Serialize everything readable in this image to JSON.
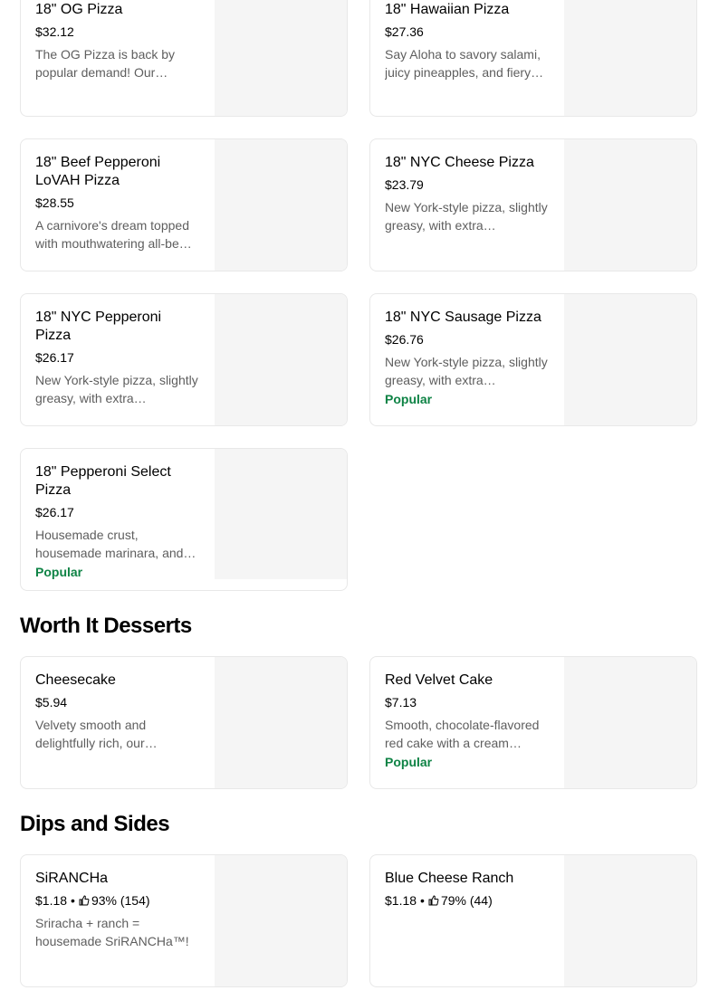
{
  "sections": {
    "desserts_heading": "Worth It Desserts",
    "dips_heading": "Dips and Sides"
  },
  "items": {
    "og_pizza": {
      "title": "18\" OG Pizza",
      "price": "$32.12",
      "desc": "The OG Pizza is back by popular demand! Our…"
    },
    "hawaiian_pizza": {
      "title": "18\" Hawaiian Pizza",
      "price": "$27.36",
      "desc": "Say Aloha to savory salami, juicy pineapples, and fiery…"
    },
    "beef_pepperoni": {
      "title": "18\" Beef Pepperoni LoVAH Pizza",
      "price": "$28.55",
      "desc": "A carnivore's dream topped with mouthwatering all-be…"
    },
    "nyc_cheese": {
      "title": "18\" NYC Cheese Pizza",
      "price": "$23.79",
      "desc": "New York-style pizza, slightly greasy, with extra…"
    },
    "nyc_pepperoni": {
      "title": "18\" NYC Pepperoni Pizza",
      "price": "$26.17",
      "desc": "New York-style pizza, slightly greasy, with extra…"
    },
    "nyc_sausage": {
      "title": "18\" NYC Sausage Pizza",
      "price": "$26.76",
      "desc": "New York-style pizza, slightly greasy, with extra…",
      "badge": "Popular"
    },
    "pepperoni_select": {
      "title": "18\" Pepperoni Select Pizza",
      "price": "$26.17",
      "desc": "Housemade crust, housemade marinara, and…",
      "badge": "Popular"
    },
    "cheesecake": {
      "title": "Cheesecake",
      "price": "$5.94",
      "desc": "Velvety smooth and delightfully rich, our…"
    },
    "red_velvet": {
      "title": "Red Velvet Cake",
      "price": "$7.13",
      "desc": "Smooth, chocolate-flavored red cake with a cream…",
      "badge": "Popular"
    },
    "sirancha": {
      "title": "SiRANCHa",
      "price": "$1.18",
      "separator": "•",
      "rating": "93% (154)",
      "desc": "Sriracha + ranch = housemade SriRANCHa™!",
      "icon": "thumbs-up-icon"
    },
    "blue_cheese": {
      "title": "Blue Cheese Ranch",
      "price": "$1.18",
      "separator": "•",
      "rating": "79% (44)",
      "icon": "thumbs-up-icon"
    }
  },
  "colors": {
    "popular_badge": "#0e8345",
    "description_text": "#5e5e5e",
    "card_border": "#e8e8e8",
    "image_placeholder": "#f5f5f5"
  }
}
